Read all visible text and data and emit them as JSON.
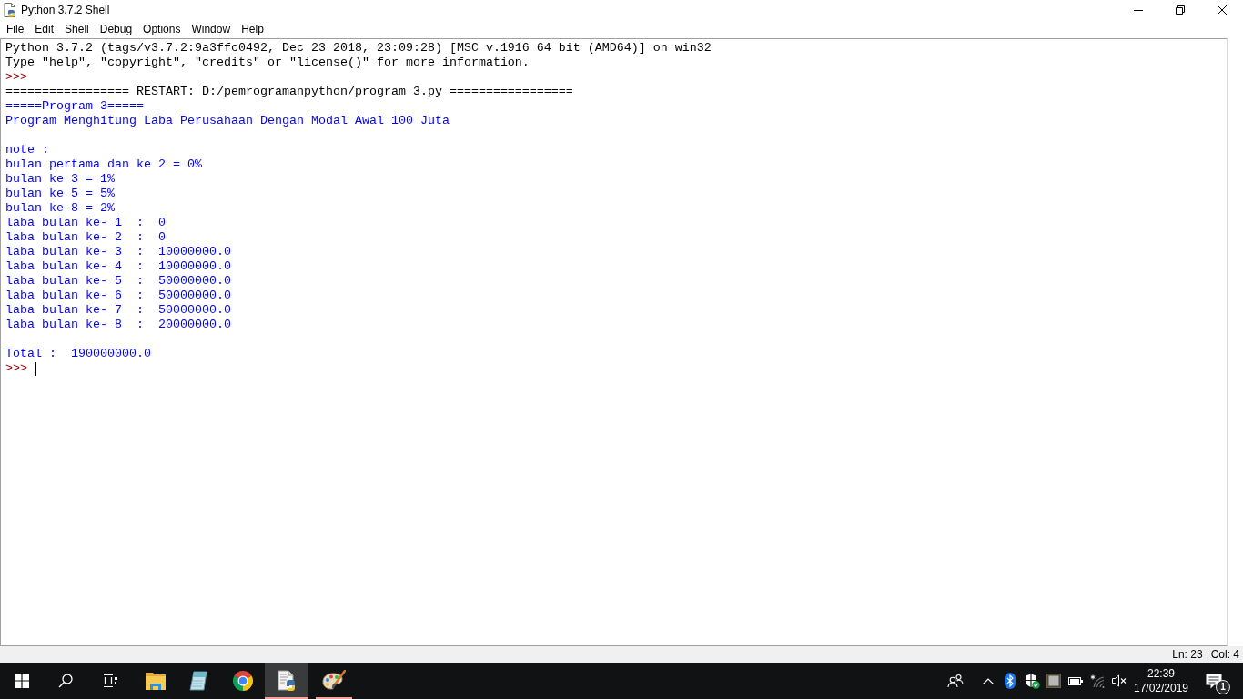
{
  "window": {
    "title": "Python 3.7.2 Shell"
  },
  "menu": [
    "File",
    "Edit",
    "Shell",
    "Debug",
    "Options",
    "Window",
    "Help"
  ],
  "shell": {
    "lines": [
      {
        "kind": "info",
        "text": "Python 3.7.2 (tags/v3.7.2:9a3ffc0492, Dec 23 2018, 23:09:28) [MSC v.1916 64 bit (AMD64)] on win32"
      },
      {
        "kind": "info",
        "text": "Type \"help\", \"copyright\", \"credits\" or \"license()\" for more information."
      },
      {
        "kind": "prompt",
        "text": ">>>",
        "cursor": false
      },
      {
        "kind": "restart",
        "text": "================= RESTART: D:/pemrogramanpython/program 3.py ================="
      },
      {
        "kind": "output",
        "text": "=====Program 3====="
      },
      {
        "kind": "output",
        "text": "Program Menghitung Laba Perusahaan Dengan Modal Awal 100 Juta"
      },
      {
        "kind": "blank"
      },
      {
        "kind": "output",
        "text": "note :"
      },
      {
        "kind": "output",
        "text": "bulan pertama dan ke 2 = 0%"
      },
      {
        "kind": "output",
        "text": "bulan ke 3 = 1%"
      },
      {
        "kind": "output",
        "text": "bulan ke 5 = 5%"
      },
      {
        "kind": "output",
        "text": "bulan ke 8 = 2%"
      },
      {
        "kind": "output",
        "text": "laba bulan ke- 1  :  0"
      },
      {
        "kind": "output",
        "text": "laba bulan ke- 2  :  0"
      },
      {
        "kind": "output",
        "text": "laba bulan ke- 3  :  10000000.0"
      },
      {
        "kind": "output",
        "text": "laba bulan ke- 4  :  10000000.0"
      },
      {
        "kind": "output",
        "text": "laba bulan ke- 5  :  50000000.0"
      },
      {
        "kind": "output",
        "text": "laba bulan ke- 6  :  50000000.0"
      },
      {
        "kind": "output",
        "text": "laba bulan ke- 7  :  50000000.0"
      },
      {
        "kind": "output",
        "text": "laba bulan ke- 8  :  20000000.0"
      },
      {
        "kind": "blank"
      },
      {
        "kind": "output",
        "text": "Total :  190000000.0"
      },
      {
        "kind": "prompt",
        "text": ">>>",
        "cursor": true
      }
    ]
  },
  "status_bar": {
    "line": "Ln: 23",
    "column": "Col: 4"
  },
  "taskbar": {
    "apps": [
      {
        "kind": "folder",
        "running": false,
        "active": false
      },
      {
        "kind": "notepad",
        "running": false,
        "active": false
      },
      {
        "kind": "browser",
        "running": false,
        "active": false
      },
      {
        "kind": "script",
        "running": true,
        "active": true
      },
      {
        "kind": "palette",
        "running": true,
        "active": false
      }
    ],
    "tray": {
      "time": "22:39",
      "date": "17/02/2019",
      "notifications": "1"
    }
  }
}
